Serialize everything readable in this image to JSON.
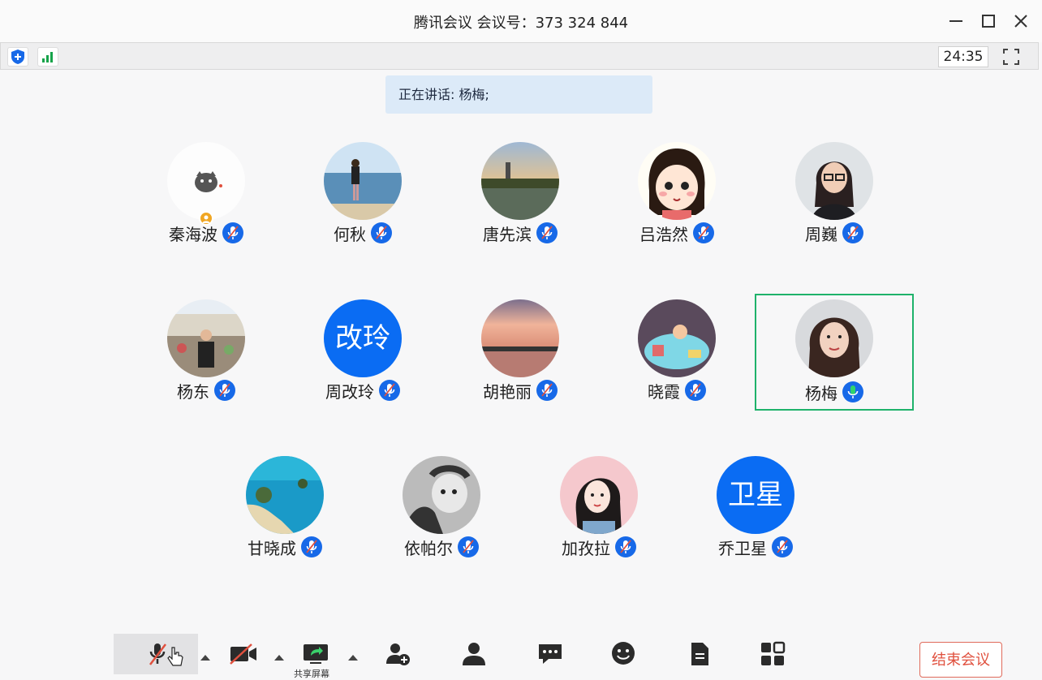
{
  "window": {
    "title": "腾讯会议 会议号：373 324 844"
  },
  "infobar": {
    "timer": "24:35"
  },
  "speaking": {
    "text": "正在讲话: 杨梅;"
  },
  "participants": [
    {
      "name": "秦海波",
      "avatar": "cat-photo",
      "host": true,
      "mic": "muted"
    },
    {
      "name": "何秋",
      "avatar": "beach-photo",
      "host": false,
      "mic": "muted"
    },
    {
      "name": "唐先滨",
      "avatar": "lake-photo",
      "host": false,
      "mic": "muted"
    },
    {
      "name": "吕浩然",
      "avatar": "cartoon-girl",
      "host": false,
      "mic": "muted"
    },
    {
      "name": "周巍",
      "avatar": "woman-glasses-photo",
      "host": false,
      "mic": "muted"
    },
    {
      "name": "杨东",
      "avatar": "man-photo",
      "host": false,
      "mic": "muted"
    },
    {
      "name": "周改玲",
      "initials": "改玲",
      "host": false,
      "mic": "muted"
    },
    {
      "name": "胡艳丽",
      "avatar": "sunset-photo",
      "host": false,
      "mic": "muted"
    },
    {
      "name": "晓霞",
      "avatar": "toys-photo",
      "host": false,
      "mic": "muted"
    },
    {
      "name": "杨梅",
      "avatar": "woman-photo",
      "host": false,
      "mic": "speaking",
      "active": true
    },
    {
      "name": "甘晓成",
      "avatar": "coast-photo",
      "host": false,
      "mic": "muted"
    },
    {
      "name": "依帕尔",
      "avatar": "baby-photo",
      "host": false,
      "mic": "muted"
    },
    {
      "name": "加孜拉",
      "avatar": "illustration-girl",
      "host": false,
      "mic": "muted"
    },
    {
      "name": "乔卫星",
      "initials": "卫星",
      "host": false,
      "mic": "muted"
    }
  ],
  "toolbar": {
    "share_label": "共享屏幕",
    "end_label": "结束会议"
  },
  "colors": {
    "accent": "#1769e8",
    "active_border": "#1fb26b",
    "end": "#e0503e",
    "speaking_bg": "#dceaf8"
  }
}
